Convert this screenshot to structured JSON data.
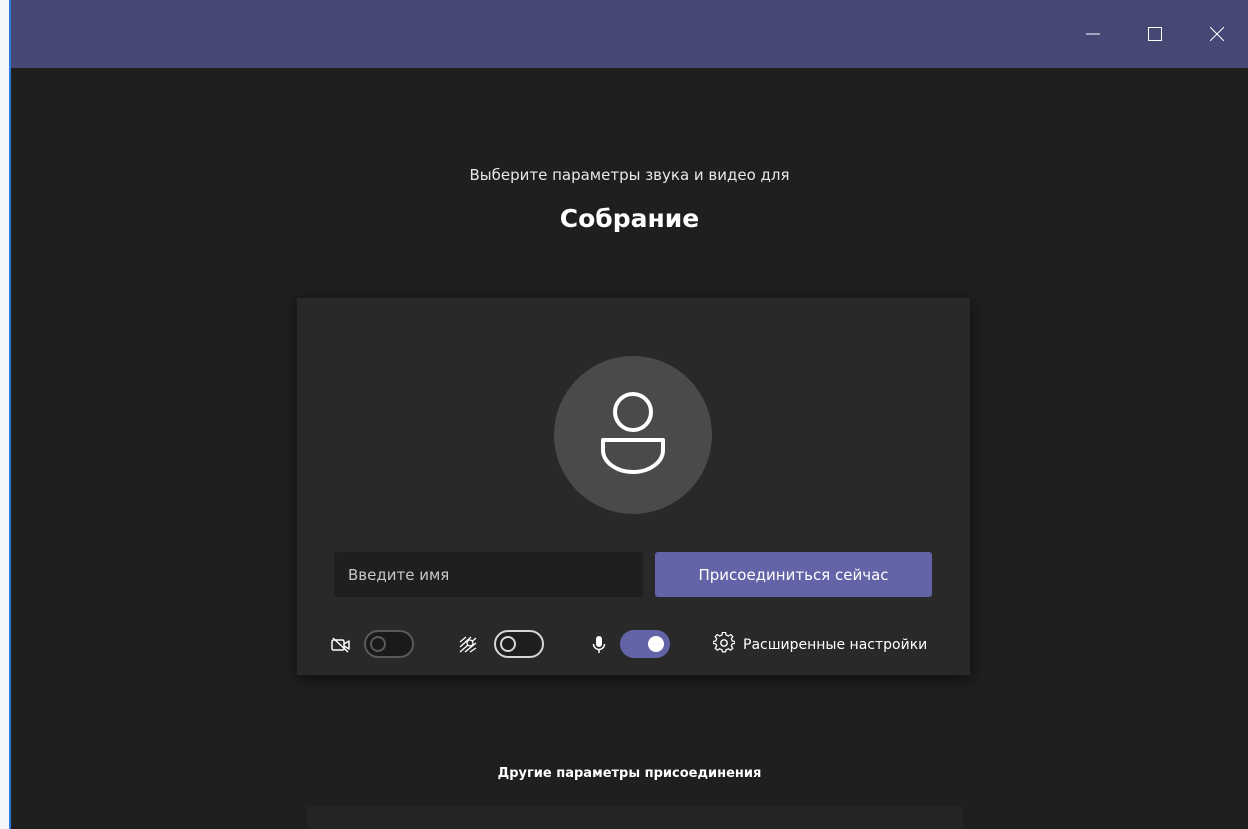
{
  "window": {
    "controls": {
      "minimize_icon": "minimize-icon",
      "maximize_icon": "maximize-icon",
      "close_icon": "close-icon"
    },
    "colors": {
      "title_bar": "#464775",
      "background": "#1f1f1f",
      "card": "#292929",
      "accent": "#6264a7"
    }
  },
  "prejoin": {
    "subtitle": "Выберите параметры звука и видео для",
    "meeting_title": "Собрание",
    "avatar_icon": "person-icon",
    "name_input": {
      "value": "",
      "placeholder": "Введите имя"
    },
    "join_button_label": "Присоединиться сейчас",
    "controls": {
      "camera": {
        "icon": "camera-off-icon",
        "state": "off-disabled"
      },
      "background_blur": {
        "icon": "background-effects-icon",
        "state": "off"
      },
      "microphone": {
        "icon": "microphone-icon",
        "state": "on"
      },
      "advanced_settings": {
        "icon": "gear-icon",
        "label": "Расширенные настройки"
      }
    }
  },
  "other_options": {
    "heading": "Другие параметры присоединения"
  }
}
